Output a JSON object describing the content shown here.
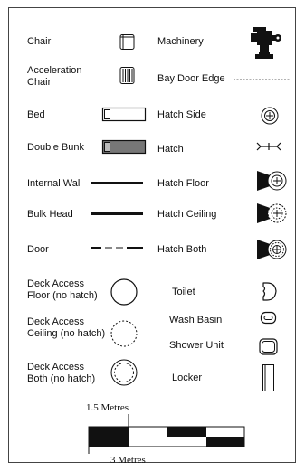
{
  "legend": {
    "left": [
      {
        "label": "Chair",
        "icon": "chair-icon"
      },
      {
        "label": "Acceleration\nChair",
        "icon": "acceleration-chair-icon"
      },
      {
        "label": "Bed",
        "icon": "bed-icon"
      },
      {
        "label": "Double Bunk",
        "icon": "double-bunk-icon"
      },
      {
        "label": "Internal Wall",
        "icon": "internal-wall-icon"
      },
      {
        "label": "Bulk Head",
        "icon": "bulk-head-icon"
      },
      {
        "label": "Door",
        "icon": "door-icon"
      },
      {
        "label": "Deck Access\nFloor (no hatch)",
        "icon": "deck-access-floor-icon"
      },
      {
        "label": "Deck Access\nCeiling (no hatch)",
        "icon": "deck-access-ceiling-icon"
      },
      {
        "label": "Deck Access\nBoth (no hatch)",
        "icon": "deck-access-both-icon"
      }
    ],
    "right": [
      {
        "label": "Machinery",
        "icon": "machinery-icon"
      },
      {
        "label": "Bay Door Edge",
        "icon": "bay-door-edge-icon"
      },
      {
        "label": "Hatch Side",
        "icon": "hatch-side-icon"
      },
      {
        "label": "Hatch",
        "icon": "hatch-icon"
      },
      {
        "label": "Hatch Floor",
        "icon": "hatch-floor-icon"
      },
      {
        "label": "Hatch Ceiling",
        "icon": "hatch-ceiling-icon"
      },
      {
        "label": "Hatch Both",
        "icon": "hatch-both-icon"
      },
      {
        "label": "Toilet",
        "icon": "toilet-icon"
      },
      {
        "label": "Wash Basin",
        "icon": "wash-basin-icon"
      },
      {
        "label": "Shower Unit",
        "icon": "shower-unit-icon"
      },
      {
        "label": "Locker",
        "icon": "locker-icon"
      }
    ]
  },
  "scale": {
    "top_label": "1.5 Metres",
    "bottom_label": "3 Metres"
  },
  "colors": {
    "ink": "#111111",
    "bunk_fill": "#777777"
  }
}
